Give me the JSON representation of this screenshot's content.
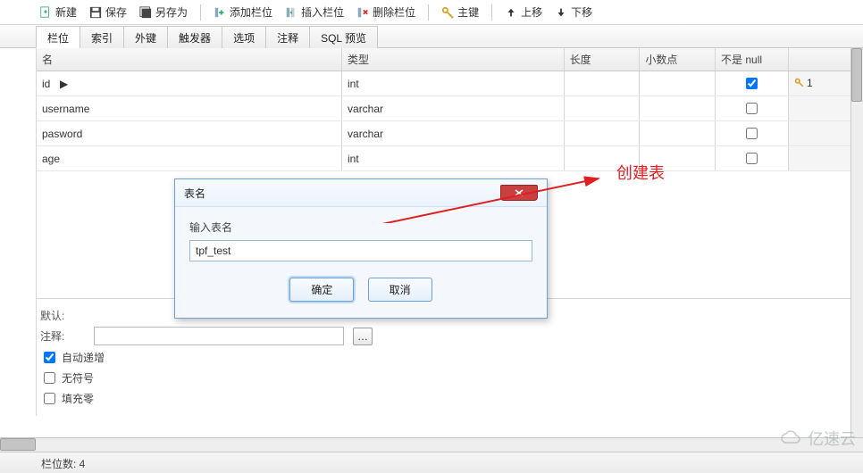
{
  "toolbar": {
    "new": "新建",
    "save": "保存",
    "saveas": "另存为",
    "addcol": "添加栏位",
    "insertcol": "插入栏位",
    "delcol": "删除栏位",
    "pk": "主键",
    "moveup": "上移",
    "movedown": "下移"
  },
  "tabs": [
    "栏位",
    "索引",
    "外键",
    "触发器",
    "选项",
    "注释",
    "SQL 预览"
  ],
  "columns_header": {
    "name": "名",
    "type": "类型",
    "len": "长度",
    "dec": "小数点",
    "notnull": "不是 null",
    "extra": ""
  },
  "rows": [
    {
      "name": "id",
      "type": "int",
      "len": "",
      "dec": "",
      "notnull": true,
      "key": "1"
    },
    {
      "name": "username",
      "type": "varchar",
      "len": "",
      "dec": "",
      "notnull": false,
      "key": ""
    },
    {
      "name": "pasword",
      "type": "varchar",
      "len": "",
      "dec": "",
      "notnull": false,
      "key": ""
    },
    {
      "name": "age",
      "type": "int",
      "len": "",
      "dec": "",
      "notnull": false,
      "key": ""
    }
  ],
  "form": {
    "default_label": "默认:",
    "comment_label": "注释:",
    "autoinc": "自动递增",
    "autoinc_checked": true,
    "unsigned": "无符号",
    "unsigned_checked": false,
    "zerofill": "填充零",
    "zerofill_checked": false
  },
  "dialog": {
    "title": "表名",
    "label": "输入表名",
    "value": "tpf_test",
    "ok": "确定",
    "cancel": "取消"
  },
  "annotation": "创建表",
  "status": "栏位数: 4",
  "watermark": "亿速云"
}
